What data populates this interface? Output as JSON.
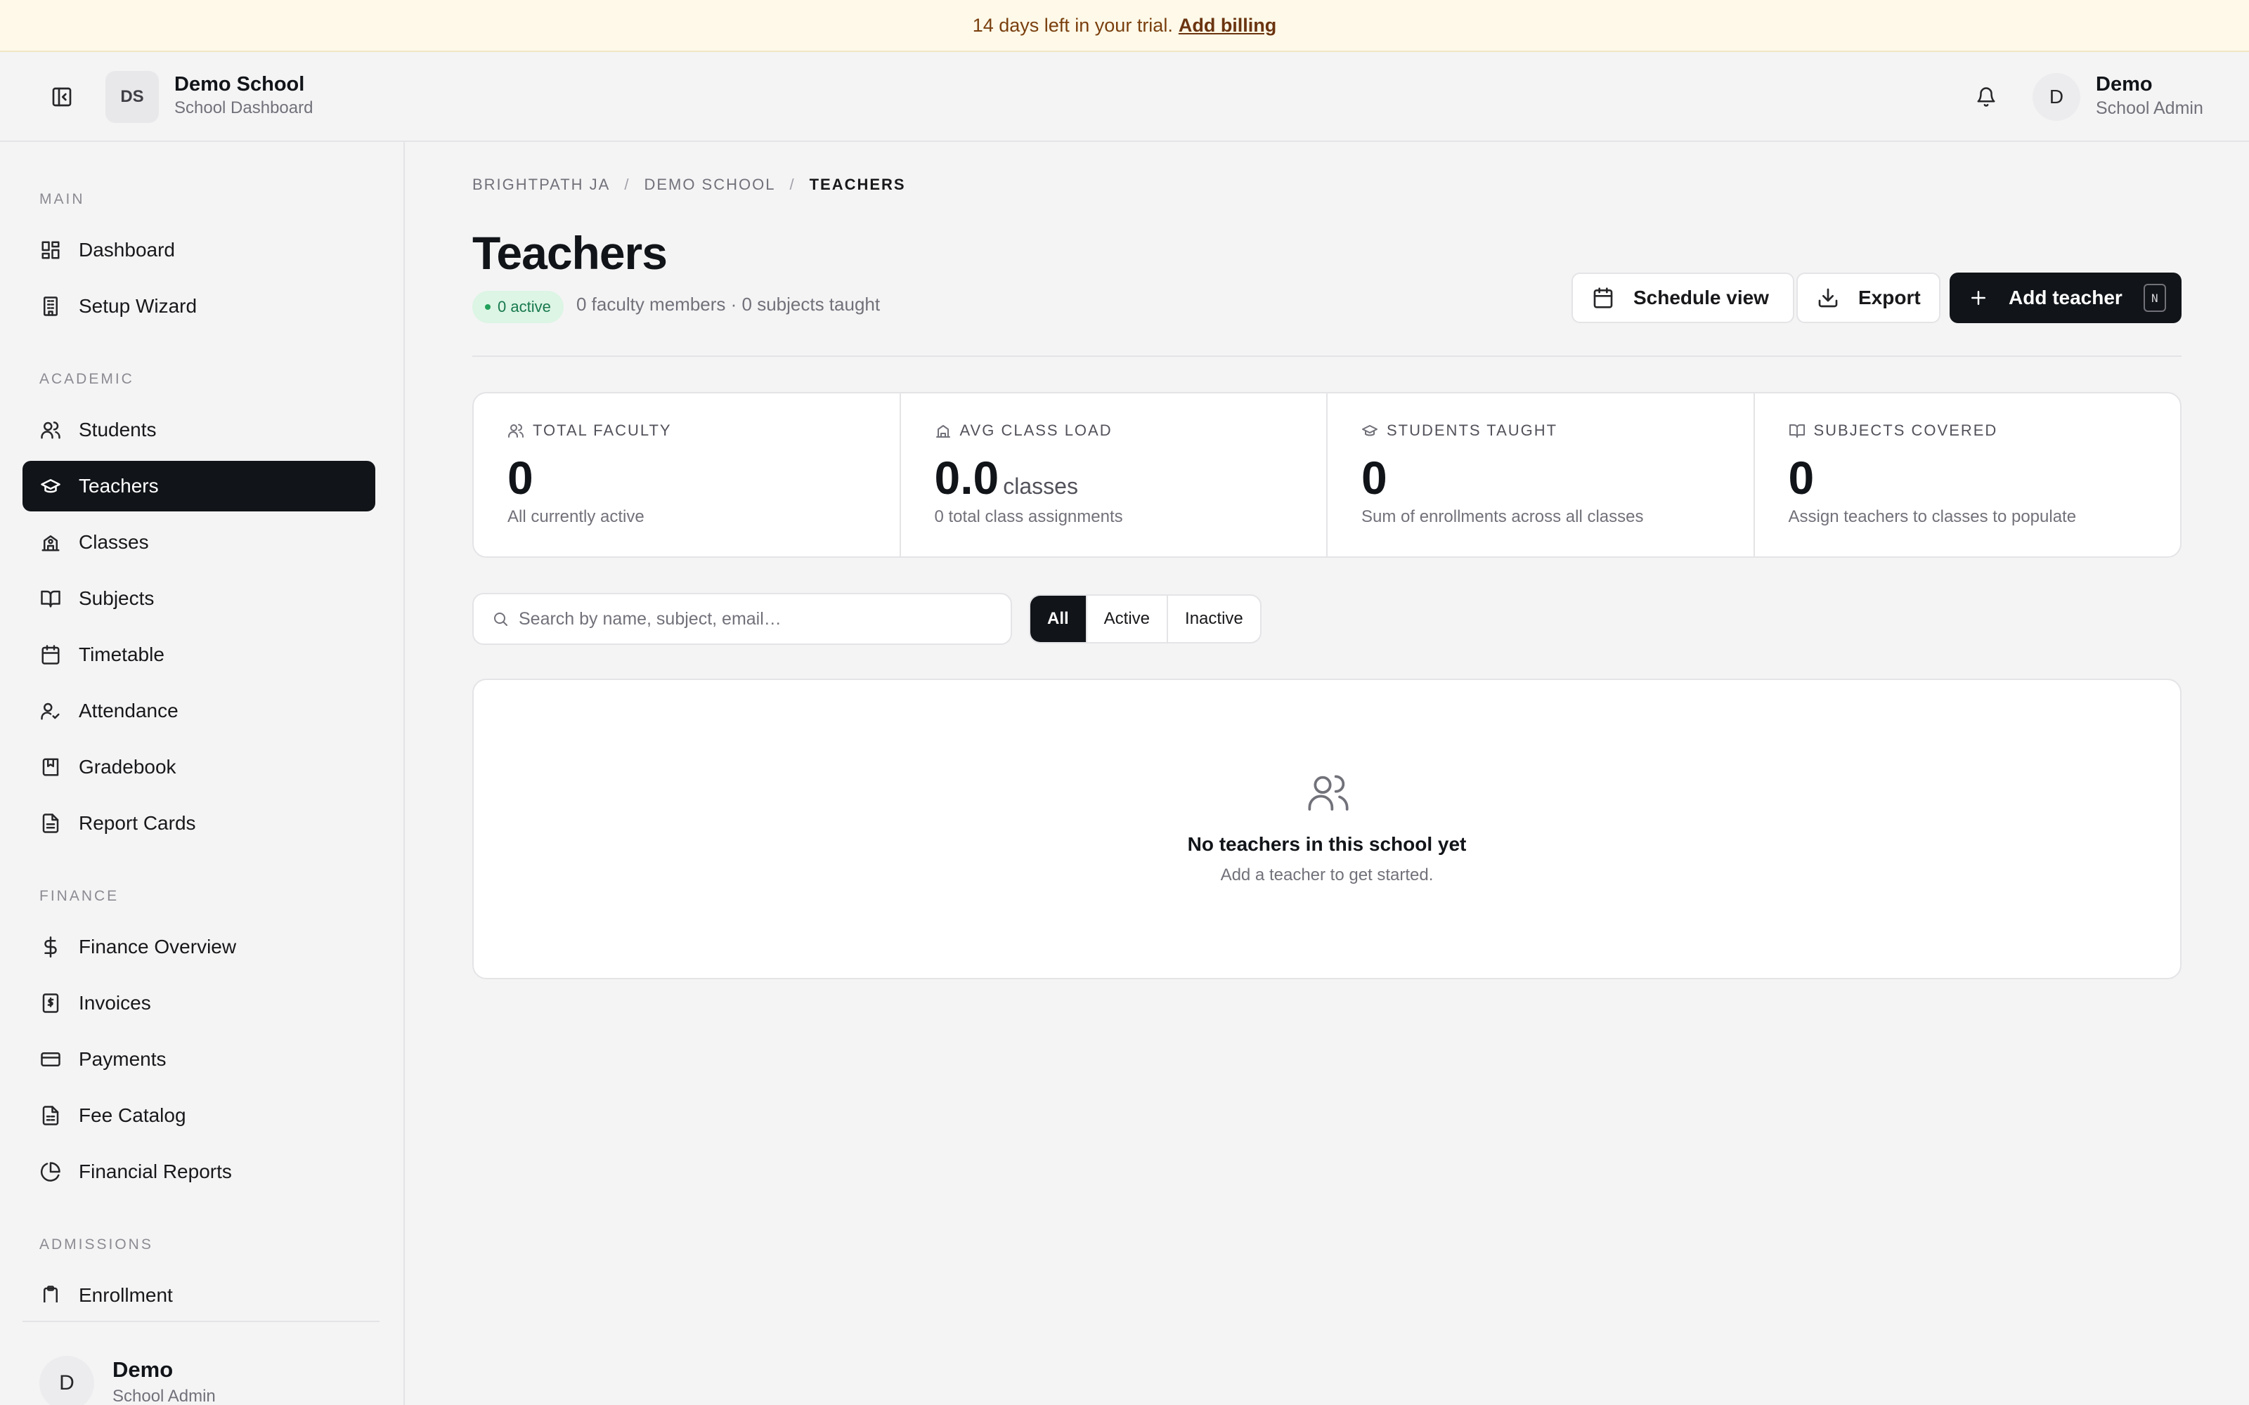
{
  "banner": {
    "text": "14 days left in your trial.",
    "link": "Add billing"
  },
  "header": {
    "school_initials": "DS",
    "school_name": "Demo School",
    "school_subtitle": "School Dashboard",
    "user_initial": "D",
    "user_name": "Demo",
    "user_role": "School Admin"
  },
  "sidebar": {
    "groups": {
      "main": "MAIN",
      "academic": "ACADEMIC",
      "finance": "FINANCE",
      "admissions": "ADMISSIONS"
    },
    "items": {
      "dashboard": "Dashboard",
      "setup_wizard": "Setup Wizard",
      "students": "Students",
      "teachers": "Teachers",
      "classes": "Classes",
      "subjects": "Subjects",
      "timetable": "Timetable",
      "attendance": "Attendance",
      "gradebook": "Gradebook",
      "report_cards": "Report Cards",
      "finance_overview": "Finance Overview",
      "invoices": "Invoices",
      "payments": "Payments",
      "fee_catalog": "Fee Catalog",
      "financial_reports": "Financial Reports",
      "enrollment": "Enrollment"
    },
    "active": "teachers",
    "footer": {
      "initial": "D",
      "name": "Demo",
      "role": "School Admin"
    }
  },
  "breadcrumb": [
    "BRIGHTPATH JA",
    "DEMO SCHOOL",
    "TEACHERS"
  ],
  "page": {
    "title": "Teachers",
    "active_badge": "0 active",
    "summary": "0 faculty members · 0 subjects taught"
  },
  "actions": {
    "schedule_view": "Schedule view",
    "export": "Export",
    "add_teacher": "Add teacher",
    "add_shortcut": "N"
  },
  "stats": [
    {
      "label": "TOTAL FACULTY",
      "value": "0",
      "unit": "",
      "note": "All currently active"
    },
    {
      "label": "AVG CLASS LOAD",
      "value": "0.0",
      "unit": "classes",
      "note": "0 total class assignments"
    },
    {
      "label": "STUDENTS TAUGHT",
      "value": "0",
      "unit": "",
      "note": "Sum of enrollments across all classes"
    },
    {
      "label": "SUBJECTS COVERED",
      "value": "0",
      "unit": "",
      "note": "Assign teachers to classes to populate"
    }
  ],
  "search": {
    "placeholder": "Search by name, subject, email…",
    "value": ""
  },
  "filters": {
    "options": [
      "All",
      "Active",
      "Inactive"
    ],
    "selected": "All"
  },
  "empty_state": {
    "title": "No teachers in this school yet",
    "subtitle": "Add a teacher to get started."
  },
  "colors": {
    "accent_dark": "#111418",
    "active_green": "#18794e",
    "banner_bg": "#fef9e8",
    "banner_text": "#7a3f0e"
  }
}
